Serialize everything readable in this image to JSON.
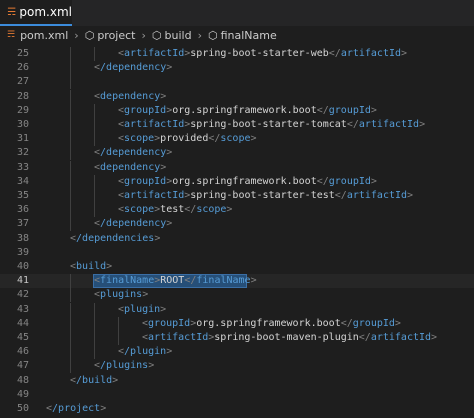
{
  "tab": {
    "icon": "rss-icon",
    "label": "pom.xml"
  },
  "breadcrumbs": [
    {
      "label": "pom.xml",
      "icon": "rss-icon"
    },
    {
      "label": "project",
      "icon": "element-icon"
    },
    {
      "label": "build",
      "icon": "element-icon"
    },
    {
      "label": "finalName",
      "icon": "element-icon"
    }
  ],
  "lines": [
    {
      "num": "25",
      "tag": "artifactId",
      "text": "spring-boot-starter-web"
    },
    {
      "num": "26",
      "tag": "/dependency"
    },
    {
      "num": "27"
    },
    {
      "num": "28",
      "tag": "dependency"
    },
    {
      "num": "29",
      "tag": "groupId",
      "text": "org.springframework.boot"
    },
    {
      "num": "30",
      "tag": "artifactId",
      "text": "spring-boot-starter-tomcat"
    },
    {
      "num": "31",
      "tag": "scope",
      "text": "provided"
    },
    {
      "num": "32",
      "tag": "/dependency"
    },
    {
      "num": "33",
      "tag": "dependency"
    },
    {
      "num": "34",
      "tag": "groupId",
      "text": "org.springframework.boot"
    },
    {
      "num": "35",
      "tag": "artifactId",
      "text": "spring-boot-starter-test"
    },
    {
      "num": "36",
      "tag": "scope",
      "text": "test"
    },
    {
      "num": "37",
      "tag": "/dependency"
    },
    {
      "num": "38",
      "tag": "/dependencies"
    },
    {
      "num": "39"
    },
    {
      "num": "40",
      "tag": "build"
    },
    {
      "num": "41",
      "tag": "finalName",
      "text": "ROOT"
    },
    {
      "num": "42",
      "tag": "plugins"
    },
    {
      "num": "43",
      "tag": "plugin"
    },
    {
      "num": "44",
      "tag": "groupId",
      "text": "org.springframework.boot"
    },
    {
      "num": "45",
      "tag": "artifactId",
      "text": "spring-boot-maven-plugin"
    },
    {
      "num": "46",
      "tag": "/plugin"
    },
    {
      "num": "47",
      "tag": "/plugins"
    },
    {
      "num": "48",
      "tag": "/build"
    },
    {
      "num": "49"
    },
    {
      "num": "50",
      "tag": "/project"
    }
  ],
  "colors": {
    "tag": "#569cd6",
    "bracket": "#808080",
    "text": "#d4d4d4",
    "line_number": "#858585",
    "selection": "#264f78",
    "tab_accent": "#3c8cdc",
    "file_icon": "#e37933"
  }
}
